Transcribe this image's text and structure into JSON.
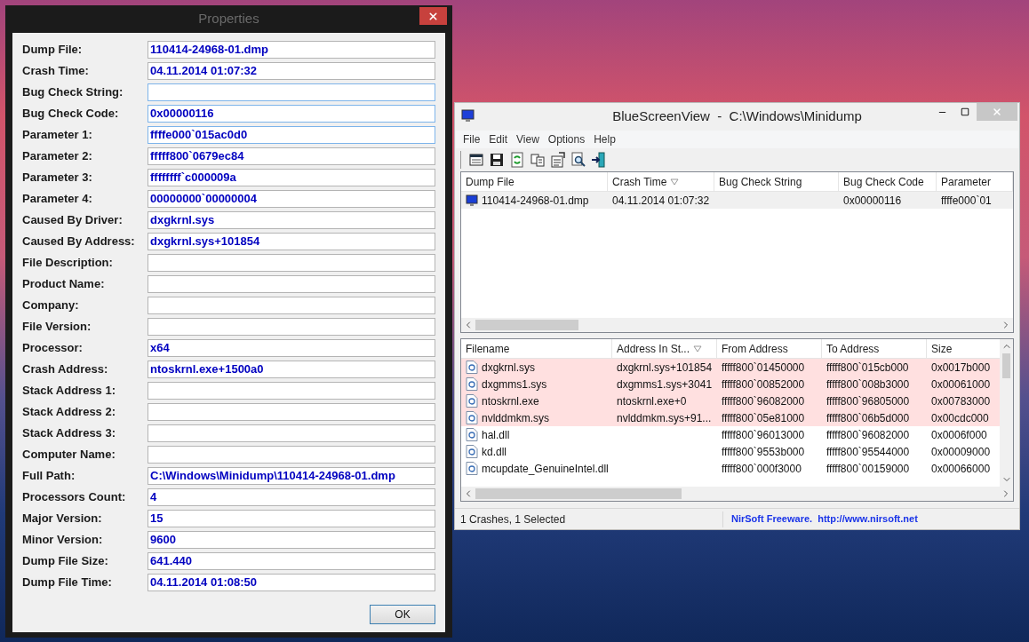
{
  "properties_dialog": {
    "title": "Properties",
    "fields": [
      {
        "label": "Dump File:",
        "value": "110414-24968-01.dmp",
        "highlighted": false
      },
      {
        "label": "Crash Time:",
        "value": "04.11.2014 01:07:32",
        "highlighted": false
      },
      {
        "label": "Bug Check String:",
        "highlighted": true
      },
      {
        "label": "Bug Check Code:",
        "value": "0x00000116",
        "highlighted": true
      },
      {
        "label": "Parameter 1:",
        "value": "ffffe000`015ac0d0",
        "highlighted": true
      },
      {
        "label": "Parameter 2:",
        "value": "fffff800`0679ec84",
        "highlighted": false
      },
      {
        "label": "Parameter 3:",
        "value": "ffffffff`c000009a",
        "highlighted": false
      },
      {
        "label": "Parameter 4:",
        "value": "00000000`00000004",
        "highlighted": false
      },
      {
        "label": "Caused By Driver:",
        "value": "dxgkrnl.sys",
        "highlighted": false
      },
      {
        "label": "Caused By Address:",
        "value": "dxgkrnl.sys+101854",
        "highlighted": false
      },
      {
        "label": "File Description:",
        "highlighted": false
      },
      {
        "label": "Product Name:",
        "highlighted": false
      },
      {
        "label": "Company:",
        "highlighted": false
      },
      {
        "label": "File Version:",
        "highlighted": false
      },
      {
        "label": "Processor:",
        "value": "x64",
        "highlighted": false
      },
      {
        "label": "Crash Address:",
        "value": "ntoskrnl.exe+1500a0",
        "highlighted": false
      },
      {
        "label": "Stack Address 1:",
        "highlighted": false
      },
      {
        "label": "Stack Address 2:",
        "highlighted": false
      },
      {
        "label": "Stack Address 3:",
        "highlighted": false
      },
      {
        "label": "Computer Name:",
        "highlighted": false
      },
      {
        "label": "Full Path:",
        "value": "C:\\Windows\\Minidump\\110414-24968-01.dmp",
        "highlighted": false
      },
      {
        "label": "Processors Count:",
        "value": "4",
        "highlighted": false
      },
      {
        "label": "Major Version:",
        "value": "15",
        "highlighted": false
      },
      {
        "label": "Minor Version:",
        "value": "9600",
        "highlighted": false
      },
      {
        "label": "Dump File Size:",
        "value": "641.440",
        "highlighted": false
      },
      {
        "label": "Dump File Time:",
        "value": "04.11.2014 01:08:50",
        "highlighted": false
      }
    ],
    "ok_button": "OK"
  },
  "main_window": {
    "title": "BlueScreenView  -  C:\\Windows\\Minidump",
    "menu": [
      "File",
      "Edit",
      "View",
      "Options",
      "Help"
    ],
    "crash_table": {
      "columns": [
        {
          "label": "Dump File",
          "sorted": false
        },
        {
          "label": "Crash Time",
          "sorted": true
        },
        {
          "label": "Bug Check String",
          "sorted": false
        },
        {
          "label": "Bug Check Code",
          "sorted": false
        },
        {
          "label": "Parameter",
          "sorted": false
        }
      ],
      "rows": [
        {
          "cells": [
            "110414-24968-01.dmp",
            "04.11.2014 01:07:32",
            "",
            "0x00000116",
            "ffffe000`01"
          ],
          "selected": true
        }
      ]
    },
    "module_table": {
      "columns": [
        {
          "label": "Filename",
          "sorted": false
        },
        {
          "label": "Address In St...",
          "sorted": true
        },
        {
          "label": "From Address",
          "sorted": false
        },
        {
          "label": "To Address",
          "sorted": false
        },
        {
          "label": "Size",
          "sorted": false
        }
      ],
      "rows": [
        {
          "cells": [
            "dxgkrnl.sys",
            "dxgkrnl.sys+101854",
            "fffff800`01450000",
            "fffff800`015cb000",
            "0x0017b000"
          ],
          "highlighted": true
        },
        {
          "cells": [
            "dxgmms1.sys",
            "dxgmms1.sys+3041",
            "fffff800`00852000",
            "fffff800`008b3000",
            "0x00061000"
          ],
          "highlighted": true
        },
        {
          "cells": [
            "ntoskrnl.exe",
            "ntoskrnl.exe+0",
            "fffff800`96082000",
            "fffff800`96805000",
            "0x00783000"
          ],
          "highlighted": true
        },
        {
          "cells": [
            "nvlddmkm.sys",
            "nvlddmkm.sys+91...",
            "fffff800`05e81000",
            "fffff800`06b5d000",
            "0x00cdc000"
          ],
          "highlighted": true
        },
        {
          "cells": [
            "hal.dll",
            "",
            "fffff800`96013000",
            "fffff800`96082000",
            "0x0006f000"
          ],
          "highlighted": false
        },
        {
          "cells": [
            "kd.dll",
            "",
            "fffff800`9553b000",
            "fffff800`95544000",
            "0x00009000"
          ],
          "highlighted": false
        },
        {
          "cells": [
            "mcupdate_GenuineIntel.dll",
            "",
            "fffff800`000f3000",
            "fffff800`00159000",
            "0x00066000"
          ],
          "highlighted": false
        }
      ]
    },
    "status_bar": {
      "text": "1 Crashes, 1 Selected",
      "link": "NirSoft Freeware.  http://www.nirsoft.net"
    }
  }
}
